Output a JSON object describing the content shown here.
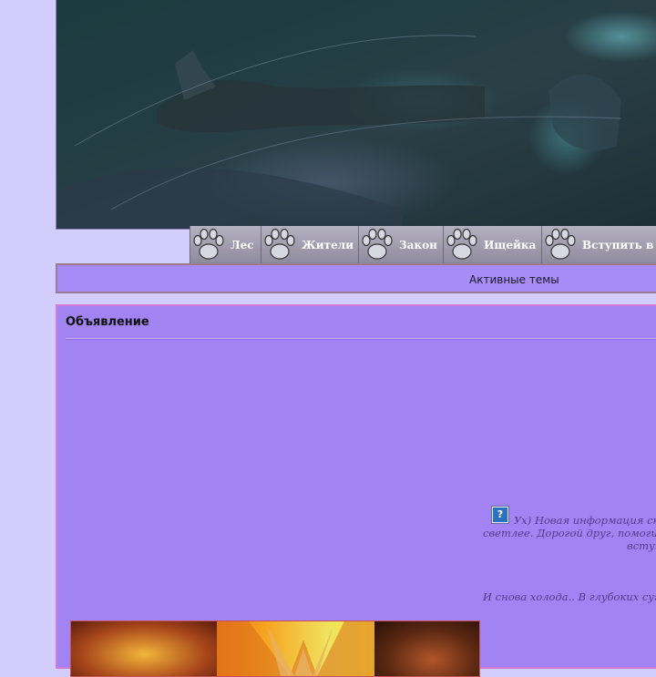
{
  "nav": {
    "items": [
      {
        "label": "Лес"
      },
      {
        "label": "Жители"
      },
      {
        "label": "Закон"
      },
      {
        "label": "Ищейка"
      },
      {
        "label": "Вступить в р"
      }
    ]
  },
  "active_topics": {
    "label": "Активные темы"
  },
  "announcement": {
    "title": "Объявление",
    "help_icon": "?",
    "lines": [
      "Ух) Новая информация ско",
      "светлее. Дорогой друг, помоги н",
      "вступ",
      "И снова холода.. В глубоких суг"
    ]
  },
  "colors": {
    "page_bg": "#d3cdfc",
    "panel_bg": "#a283f4",
    "panel_border": "#d27ad8",
    "nav_bg": "#a6a3b5",
    "message_text": "#553a8a"
  }
}
